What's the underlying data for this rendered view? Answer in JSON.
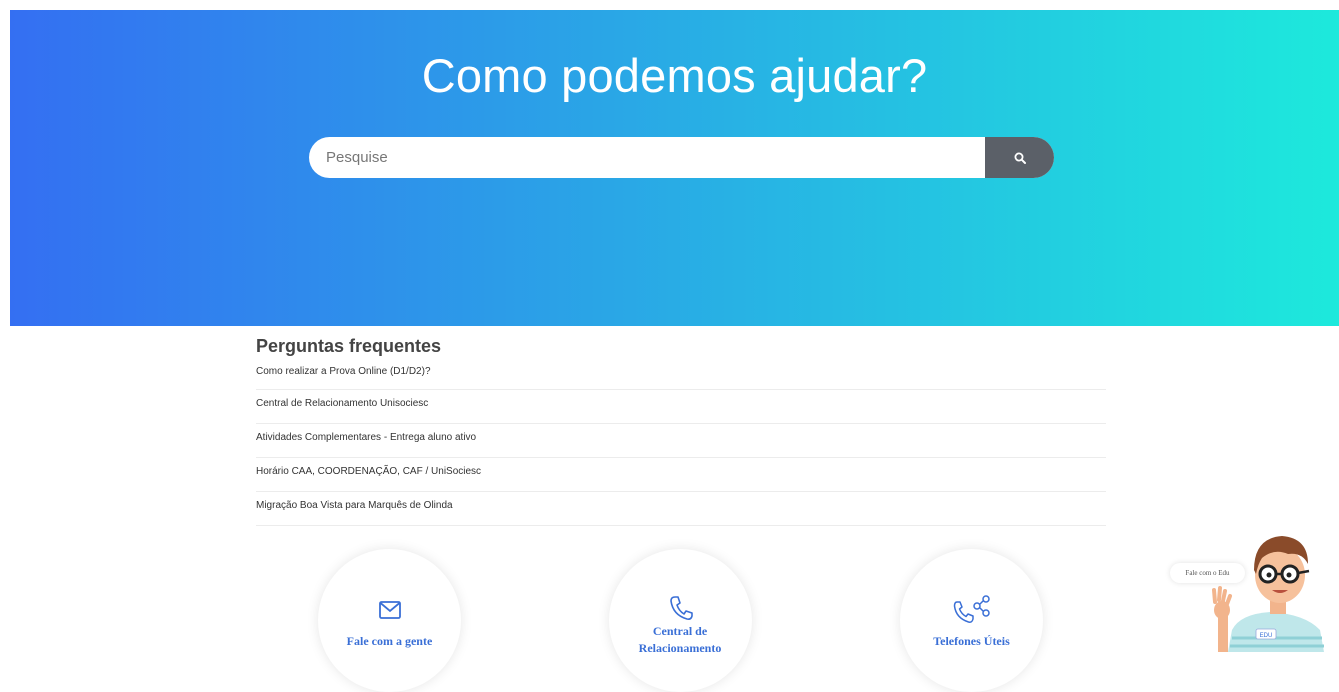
{
  "hero": {
    "title": "Como podemos ajudar?",
    "search_placeholder": "Pesquise"
  },
  "faq": {
    "title": "Perguntas frequentes",
    "items": [
      "Como realizar a Prova Online (D1/D2)?",
      "Central de Relacionamento Unisociesc",
      "Atividades Complementares - Entrega aluno ativo",
      "Horário CAA, COORDENAÇÃO, CAF / UniSociesc",
      "Migração Boa Vista para Marquês de Olinda"
    ]
  },
  "cards": [
    {
      "label": "Fale com a gente",
      "icon": "envelope-icon"
    },
    {
      "label": "Central de Relacionamento",
      "icon": "phone-icon"
    },
    {
      "label": "Telefones Úteis",
      "icon": "phone-share-icon"
    }
  ],
  "chat": {
    "bubble": "Fale com o Edu",
    "badge": "EDU"
  },
  "colors": {
    "gradient_start": "#346ff2",
    "gradient_end": "#1de9dc",
    "search_button": "#5b6068",
    "card_text": "#3a6fd6"
  }
}
